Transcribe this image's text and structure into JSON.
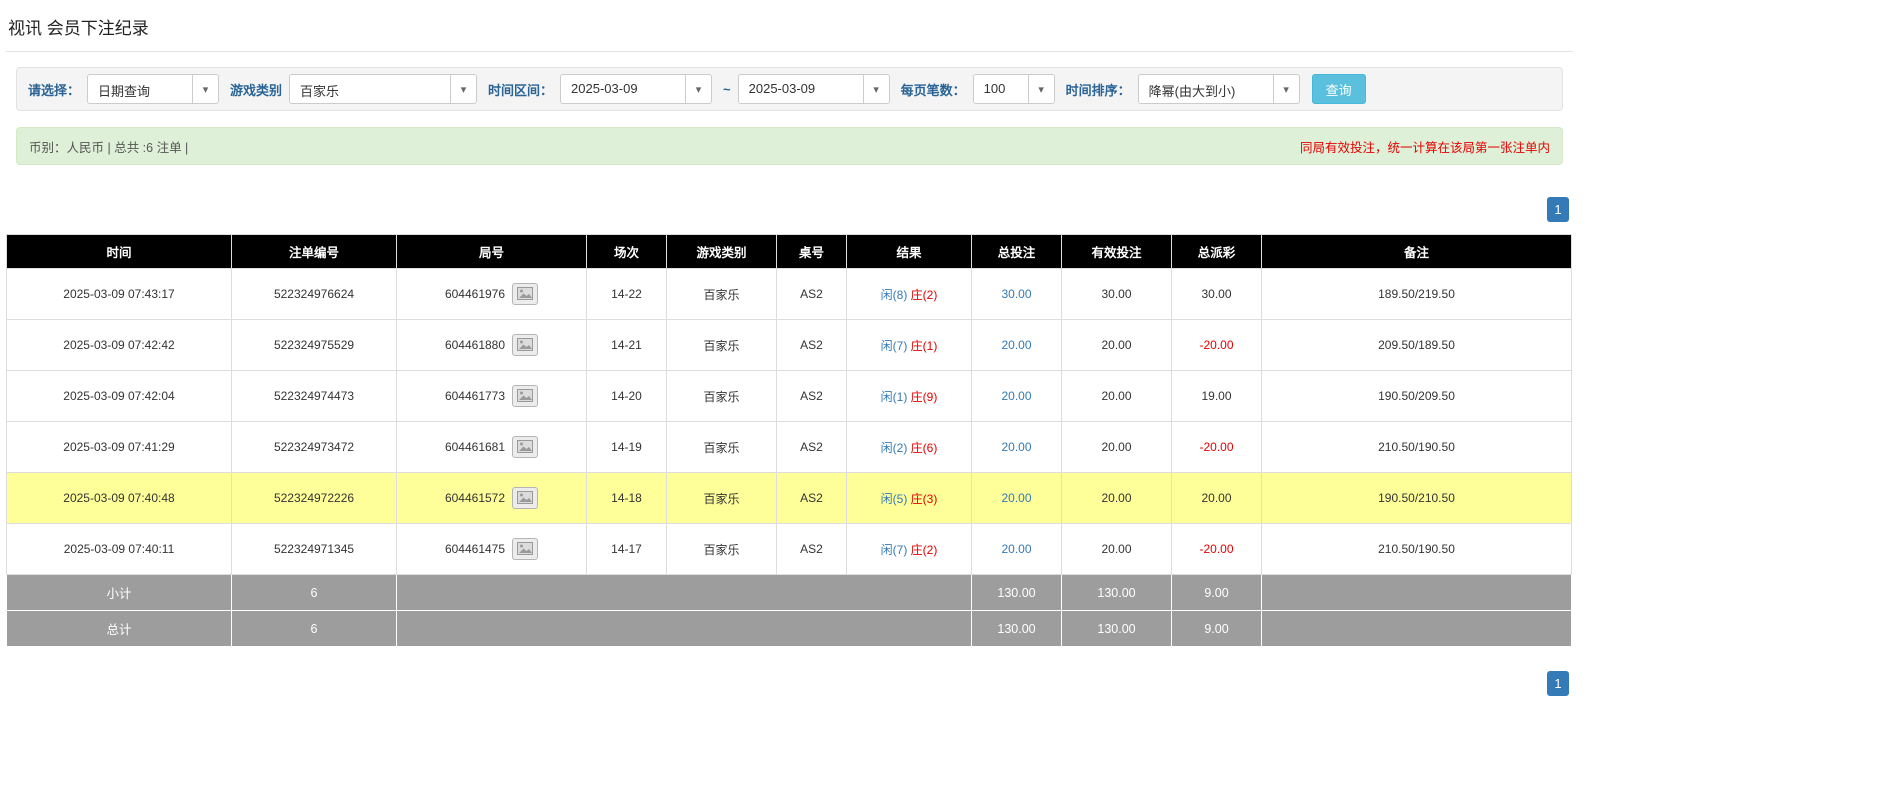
{
  "page": {
    "title": "视讯 会员下注纪录"
  },
  "icons": {
    "chevron_down": "▾"
  },
  "filters": {
    "select_label": "请选择：",
    "select_value": "日期查询",
    "game_type_label": "游戏类别",
    "game_type_value": "百家乐",
    "date_range_label": "时间区间：",
    "date_from": "2025-03-09",
    "range_separator": "~",
    "date_to": "2025-03-09",
    "page_size_label": "每页笔数：",
    "page_size_value": "100",
    "sort_label": "时间排序：",
    "sort_value": "降幂(由大到小)",
    "search_button_label": "查询"
  },
  "summary": {
    "currency_count": "币别：人民币 | 总共 :6 注单 |",
    "note": "同局有效投注，统一计算在该局第一张注单内"
  },
  "pagination": {
    "current_page": "1"
  },
  "table": {
    "headers": [
      "时间",
      "注单编号",
      "局号",
      "场次",
      "游戏类别",
      "桌号",
      "结果",
      "总投注",
      "有效投注",
      "总派彩",
      "备注"
    ],
    "rows": [
      {
        "time": "2025-03-09 07:43:17",
        "bet_id": "522324976624",
        "round_id": "604461976",
        "session": "14-22",
        "game_type": "百家乐",
        "table_no": "AS2",
        "result_player": "闲(8)",
        "result_banker": "庄(2)",
        "total_bet": "30.00",
        "valid_bet": "30.00",
        "payout": "30.00",
        "remark": "189.50/219.50",
        "highlight": false
      },
      {
        "time": "2025-03-09 07:42:42",
        "bet_id": "522324975529",
        "round_id": "604461880",
        "session": "14-21",
        "game_type": "百家乐",
        "table_no": "AS2",
        "result_player": "闲(7)",
        "result_banker": "庄(1)",
        "total_bet": "20.00",
        "valid_bet": "20.00",
        "payout": "-20.00",
        "remark": "209.50/189.50",
        "highlight": false
      },
      {
        "time": "2025-03-09 07:42:04",
        "bet_id": "522324974473",
        "round_id": "604461773",
        "session": "14-20",
        "game_type": "百家乐",
        "table_no": "AS2",
        "result_player": "闲(1)",
        "result_banker": "庄(9)",
        "total_bet": "20.00",
        "valid_bet": "20.00",
        "payout": "19.00",
        "remark": "190.50/209.50",
        "highlight": false
      },
      {
        "time": "2025-03-09 07:41:29",
        "bet_id": "522324973472",
        "round_id": "604461681",
        "session": "14-19",
        "game_type": "百家乐",
        "table_no": "AS2",
        "result_player": "闲(2)",
        "result_banker": "庄(6)",
        "total_bet": "20.00",
        "valid_bet": "20.00",
        "payout": "-20.00",
        "remark": "210.50/190.50",
        "highlight": false
      },
      {
        "time": "2025-03-09 07:40:48",
        "bet_id": "522324972226",
        "round_id": "604461572",
        "session": "14-18",
        "game_type": "百家乐",
        "table_no": "AS2",
        "result_player": "闲(5)",
        "result_banker": "庄(3)",
        "total_bet": "20.00",
        "valid_bet": "20.00",
        "payout": "20.00",
        "remark": "190.50/210.50",
        "highlight": true
      },
      {
        "time": "2025-03-09 07:40:11",
        "bet_id": "522324971345",
        "round_id": "604461475",
        "session": "14-17",
        "game_type": "百家乐",
        "table_no": "AS2",
        "result_player": "闲(7)",
        "result_banker": "庄(2)",
        "total_bet": "20.00",
        "valid_bet": "20.00",
        "payout": "-20.00",
        "remark": "210.50/190.50",
        "highlight": false
      }
    ],
    "footer_rows": [
      {
        "label": "小计",
        "count": "6",
        "total_bet": "130.00",
        "valid_bet": "130.00",
        "payout": "9.00"
      },
      {
        "label": "总计",
        "count": "6",
        "total_bet": "130.00",
        "valid_bet": "130.00",
        "payout": "9.00"
      }
    ]
  },
  "colors": {
    "accent_cyan": "#5bc0de",
    "pagination_blue": "#337ab7",
    "link_blue": "#337ab7",
    "player_blue": "#337ab7",
    "banker_red": "#e60000",
    "negative_red": "#e60000",
    "highlight_yellow": "#ffff99",
    "header_black": "#000000",
    "footer_gray": "#9d9d9d"
  }
}
